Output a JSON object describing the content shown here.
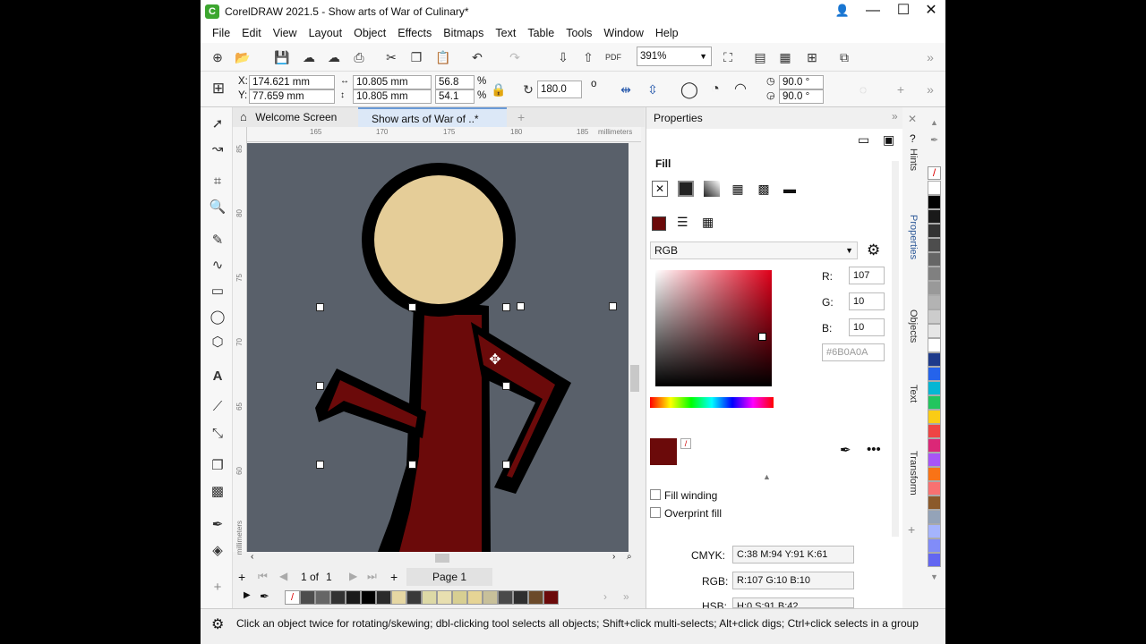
{
  "title": "CorelDRAW 2021.5 - Show arts of War of Culinary*",
  "menu": [
    "File",
    "Edit",
    "View",
    "Layout",
    "Object",
    "Effects",
    "Bitmaps",
    "Text",
    "Table",
    "Tools",
    "Window",
    "Help"
  ],
  "toolbar": {
    "zoom": "391%"
  },
  "property_bar": {
    "x_label": "X:",
    "x_value": "174.621 mm",
    "y_label": "Y:",
    "y_value": "77.659 mm",
    "width_value": "10.805 mm",
    "height_value": "10.805 mm",
    "scale_w": "56.8",
    "scale_h": "54.1",
    "percent": "%",
    "rotation": "180.0",
    "degree": "o",
    "angle_start": "90.0 °",
    "angle_end": "90.0 °"
  },
  "doc_tabs": {
    "welcome": "Welcome Screen",
    "active": "Show arts of War of ..*"
  },
  "ruler": {
    "ticks_h": [
      "165",
      "170",
      "175",
      "180",
      "185"
    ],
    "unit": "millimeters",
    "ticks_v": [
      "85",
      "80",
      "75",
      "70",
      "65",
      "60"
    ]
  },
  "page_nav": {
    "counter": "1",
    "of": "of",
    "total": "1",
    "page_tab": "Page 1"
  },
  "properties": {
    "title": "Properties",
    "section": "Fill",
    "model": "RGB",
    "r_label": "R:",
    "r_value": "107",
    "g_label": "G:",
    "g_value": "10",
    "b_label": "B:",
    "b_value": "10",
    "hex": "#6B0A0A",
    "fill_color": "#6b0a0a",
    "fill_winding": "Fill winding",
    "overprint_fill": "Overprint fill",
    "cmyk_label": "CMYK:",
    "cmyk_value": "C:38 M:94 Y:91 K:61",
    "rgb_label": "RGB:",
    "rgb_value": "R:107 G:10 B:10",
    "hsb_label": "HSB:",
    "hsb_value": "H:0 S:91 B:42"
  },
  "side_tabs": [
    "Hints",
    "Properties",
    "Objects",
    "Text",
    "Transform"
  ],
  "status": "Click an object twice for rotating/skewing; dbl-clicking tool selects all objects; Shift+click multi-selects; Alt+click digs; Ctrl+click selects in a group",
  "palette_doc": [
    "#ffffff",
    "#4d4d4d",
    "#666666",
    "#333333",
    "#1a1a1a",
    "#000000",
    "#2a2a2a",
    "#e6d7a3",
    "#3a3a3a",
    "#ddd9a6",
    "#e8dfb0",
    "#d8cf92",
    "#e6d495",
    "#c8c09a",
    "#4a4a4a",
    "#2f2f2f",
    "#6b4a2a",
    "#6b0a0a"
  ],
  "palette_side": [
    "#ffffff",
    "#000000",
    "#1a1a1a",
    "#333333",
    "#4d4d4d",
    "#666666",
    "#808080",
    "#999999",
    "#b3b3b3",
    "#cccccc",
    "#e6e6e6",
    "#ffffff",
    "#1e3a8a",
    "#2563eb",
    "#06b6d4",
    "#22c55e",
    "#facc15",
    "#ef4444",
    "#db2777",
    "#a855f7",
    "#f97316",
    "#f87171",
    "#8b5a2b",
    "#94a3b8",
    "#a5b4fc",
    "#818cf8",
    "#6366f1"
  ]
}
